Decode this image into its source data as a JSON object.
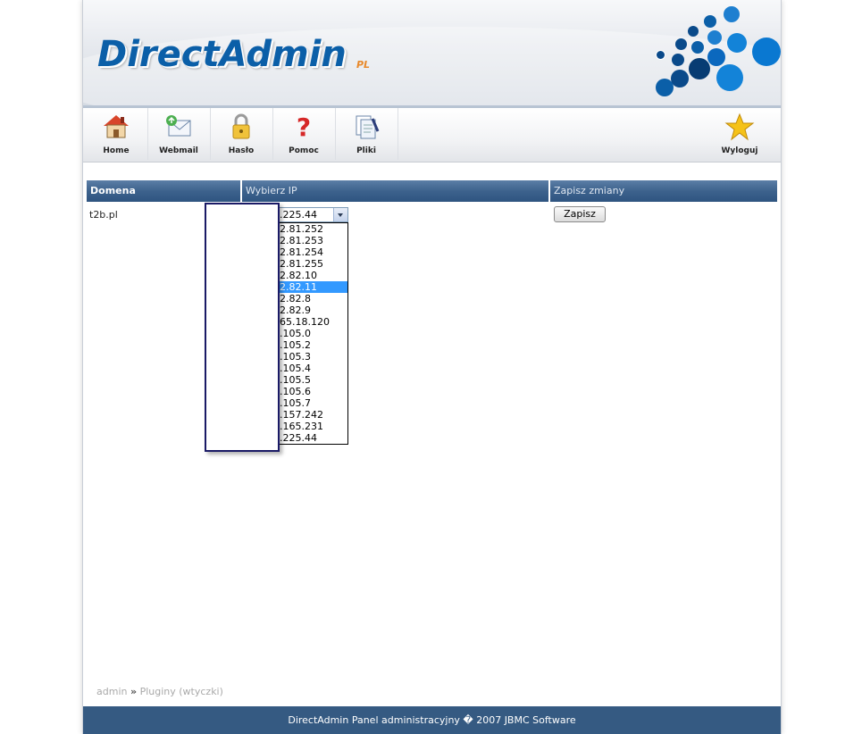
{
  "header": {
    "logo_text": "DirectAdmin",
    "logo_suffix": "PL"
  },
  "toolbar": {
    "items": [
      {
        "label": "Home",
        "icon": "house-icon"
      },
      {
        "label": "Webmail",
        "icon": "envelope-icon"
      },
      {
        "label": "Hasło",
        "icon": "padlock-icon"
      },
      {
        "label": "Pomoc",
        "icon": "question-icon"
      },
      {
        "label": "Pliki",
        "icon": "files-icon"
      },
      {
        "label": "Wyloguj",
        "icon": "star-icon"
      }
    ]
  },
  "table": {
    "headers": [
      "Domena",
      "Wybierz IP",
      "Zapisz zmiany"
    ],
    "row": {
      "domain": "t2b.pl",
      "selected_ip": ".225.44",
      "save_label": "Zapisz"
    }
  },
  "dropdown": {
    "options": [
      "2.81.252",
      "2.81.253",
      "2.81.254",
      "2.81.255",
      "2.82.10",
      "2.82.11",
      "2.82.8",
      "2.82.9",
      "65.18.120",
      ".105.0",
      ".105.2",
      ".105.3",
      ".105.4",
      ".105.5",
      ".105.6",
      ".105.7",
      ".157.242",
      ".165.231",
      ".225.44"
    ],
    "highlighted_index": 5
  },
  "breadcrumb": {
    "user": "admin",
    "separator": "»",
    "page": "Pluginy (wtyczki)"
  },
  "footer": {
    "text": "DirectAdmin Panel administracyjny � 2007 JBMC Software"
  },
  "colors": {
    "header_blue": "#0b5fa8",
    "table_header": "#3d628d",
    "footer": "#355a82",
    "selection": "#3399ff"
  }
}
